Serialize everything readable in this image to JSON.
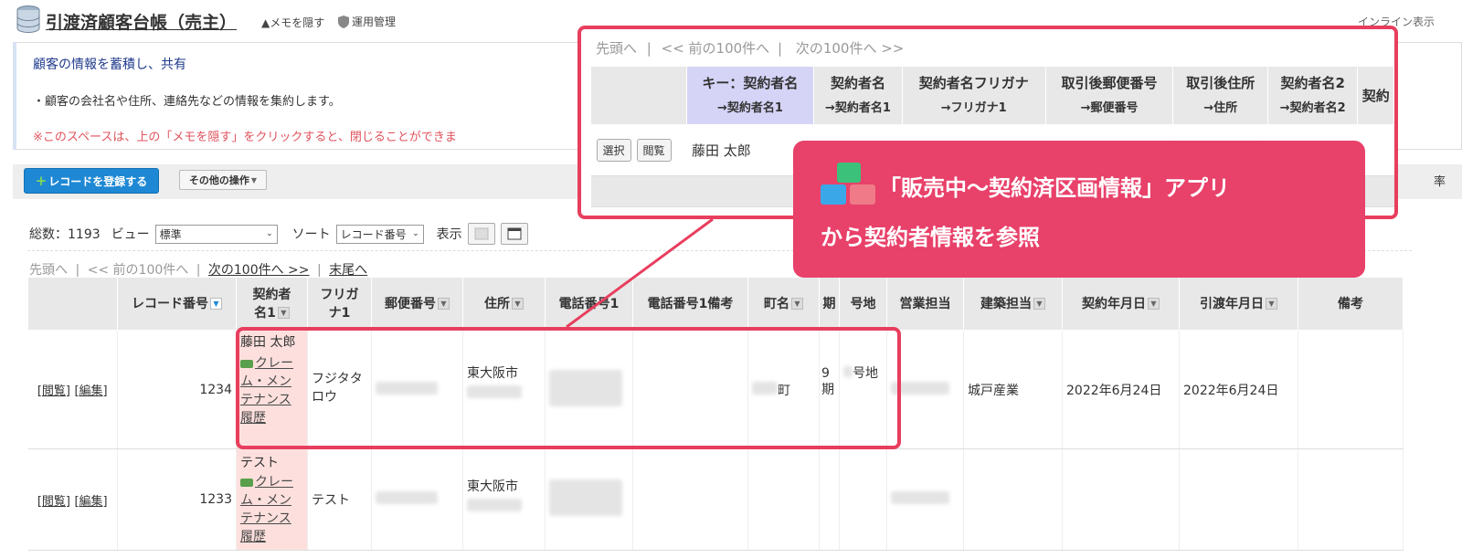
{
  "header": {
    "title": "引渡済顧客台帳（売主）",
    "hide_memo": "▲メモを隠す",
    "ops_mgmt": "運用管理",
    "inline_view": "インライン表示"
  },
  "memo": {
    "heading": "顧客の情報を蓄積し、共有",
    "line1": "・顧客の会社名や住所、連絡先などの情報を集約します。",
    "line2": "※このスペースは、上の「メモを隠す」をクリックすると、閉じることができま"
  },
  "toolbar": {
    "register_label": "レコードを登録する",
    "other_ops_label": "その他の操作",
    "right_link": "率"
  },
  "controls": {
    "total_label": "総数：1193",
    "view_label": "ビュー",
    "view_value": "標準",
    "sort_label": "ソート",
    "sort_value": "レコード番号",
    "display_label": "表示"
  },
  "pager": {
    "first": "先頭へ",
    "prev": "<< 前の100件へ",
    "next": "次の100件へ >>",
    "last": "末尾へ",
    "sep": "|"
  },
  "columns": {
    "c0": "",
    "c1": "レコード番号",
    "c2a": "契約者",
    "c2b": "名1",
    "c3a": "フリガ",
    "c3b": "ナ1",
    "c4": "郵便番号",
    "c5": "住所",
    "c6": "電話番号1",
    "c7": "電話番号1備考",
    "c8": "町名",
    "c9": "期",
    "c10": "号地",
    "c11": "営業担当",
    "c12": "建築担当",
    "c13": "契約年月日",
    "c14": "引渡年月日",
    "c15": "備考"
  },
  "rows": [
    {
      "view": "[閲覧]",
      "edit": "[編集]",
      "record_no": "1234",
      "name": "藤田 太郎",
      "claim_link": "クレーム・メンテナンス履歴",
      "furigana": "フジタタロウ",
      "city": "東大阪市",
      "town_suffix": "町",
      "period": "9期",
      "lot": "号地",
      "builder": "城戸産業",
      "contract_date": "2022年6月24日",
      "handover_date": "2022年6月24日"
    },
    {
      "view": "[閲覧]",
      "edit": "[編集]",
      "record_no": "1233",
      "name": "テスト",
      "claim_link": "クレーム・メンテナンス履歴",
      "furigana": "テスト",
      "city": "東大阪市",
      "town_suffix": "",
      "period": "",
      "lot": "",
      "builder": "",
      "contract_date": "",
      "handover_date": ""
    }
  ],
  "popup": {
    "nav_first": "先頭へ",
    "nav_prev": "<< 前の100件へ",
    "nav_next": "次の100件へ >>",
    "sep": "|",
    "headers": [
      {
        "main": "キー：契約者名",
        "sub": "→契約者名1"
      },
      {
        "main": "契約者名",
        "sub": "→契約者名1"
      },
      {
        "main": "契約者名フリガナ",
        "sub": "→フリガナ1"
      },
      {
        "main": "取引後郵便番号",
        "sub": "→郵便番号"
      },
      {
        "main": "取引後住所",
        "sub": "→住所"
      },
      {
        "main": "契約者名2",
        "sub": "→契約者名2"
      },
      {
        "main": "契約",
        "sub": ""
      }
    ],
    "select_label": "選択",
    "view_label": "閲覧",
    "row_name": "藤田 太郎"
  },
  "callout": {
    "line1": "「販売中〜契約済区画情報」アプリ",
    "line2": "から契約者情報を参照"
  },
  "colors": {
    "accent": "#e8416a",
    "primary_button": "#1e88d4",
    "key_header": "#d5d4f7",
    "name_cell": "#fde0dd"
  }
}
